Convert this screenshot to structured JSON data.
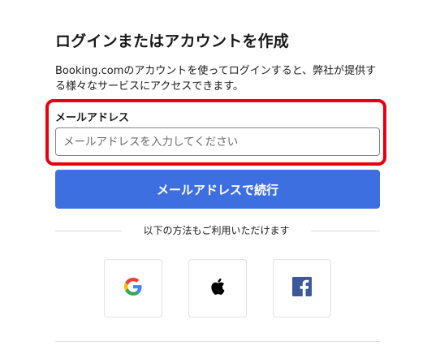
{
  "page": {
    "title": "ログインまたはアカウントを作成",
    "description": "Booking.comのアカウントを使ってログインすると、弊社が提供する様々なサービスにアクセスできます。"
  },
  "email": {
    "label": "メールアドレス",
    "placeholder": "メールアドレスを入力してください",
    "value": "",
    "highlight_color": "#e8000b"
  },
  "continue_button": {
    "label": "メールアドレスで続行",
    "color": "#3e6fe0"
  },
  "divider": {
    "text": "以下の方法もご利用いただけます"
  },
  "social": [
    {
      "name": "google",
      "icon": "google-icon"
    },
    {
      "name": "apple",
      "icon": "apple-icon"
    },
    {
      "name": "facebook",
      "icon": "facebook-icon",
      "color": "#3b5998"
    }
  ]
}
